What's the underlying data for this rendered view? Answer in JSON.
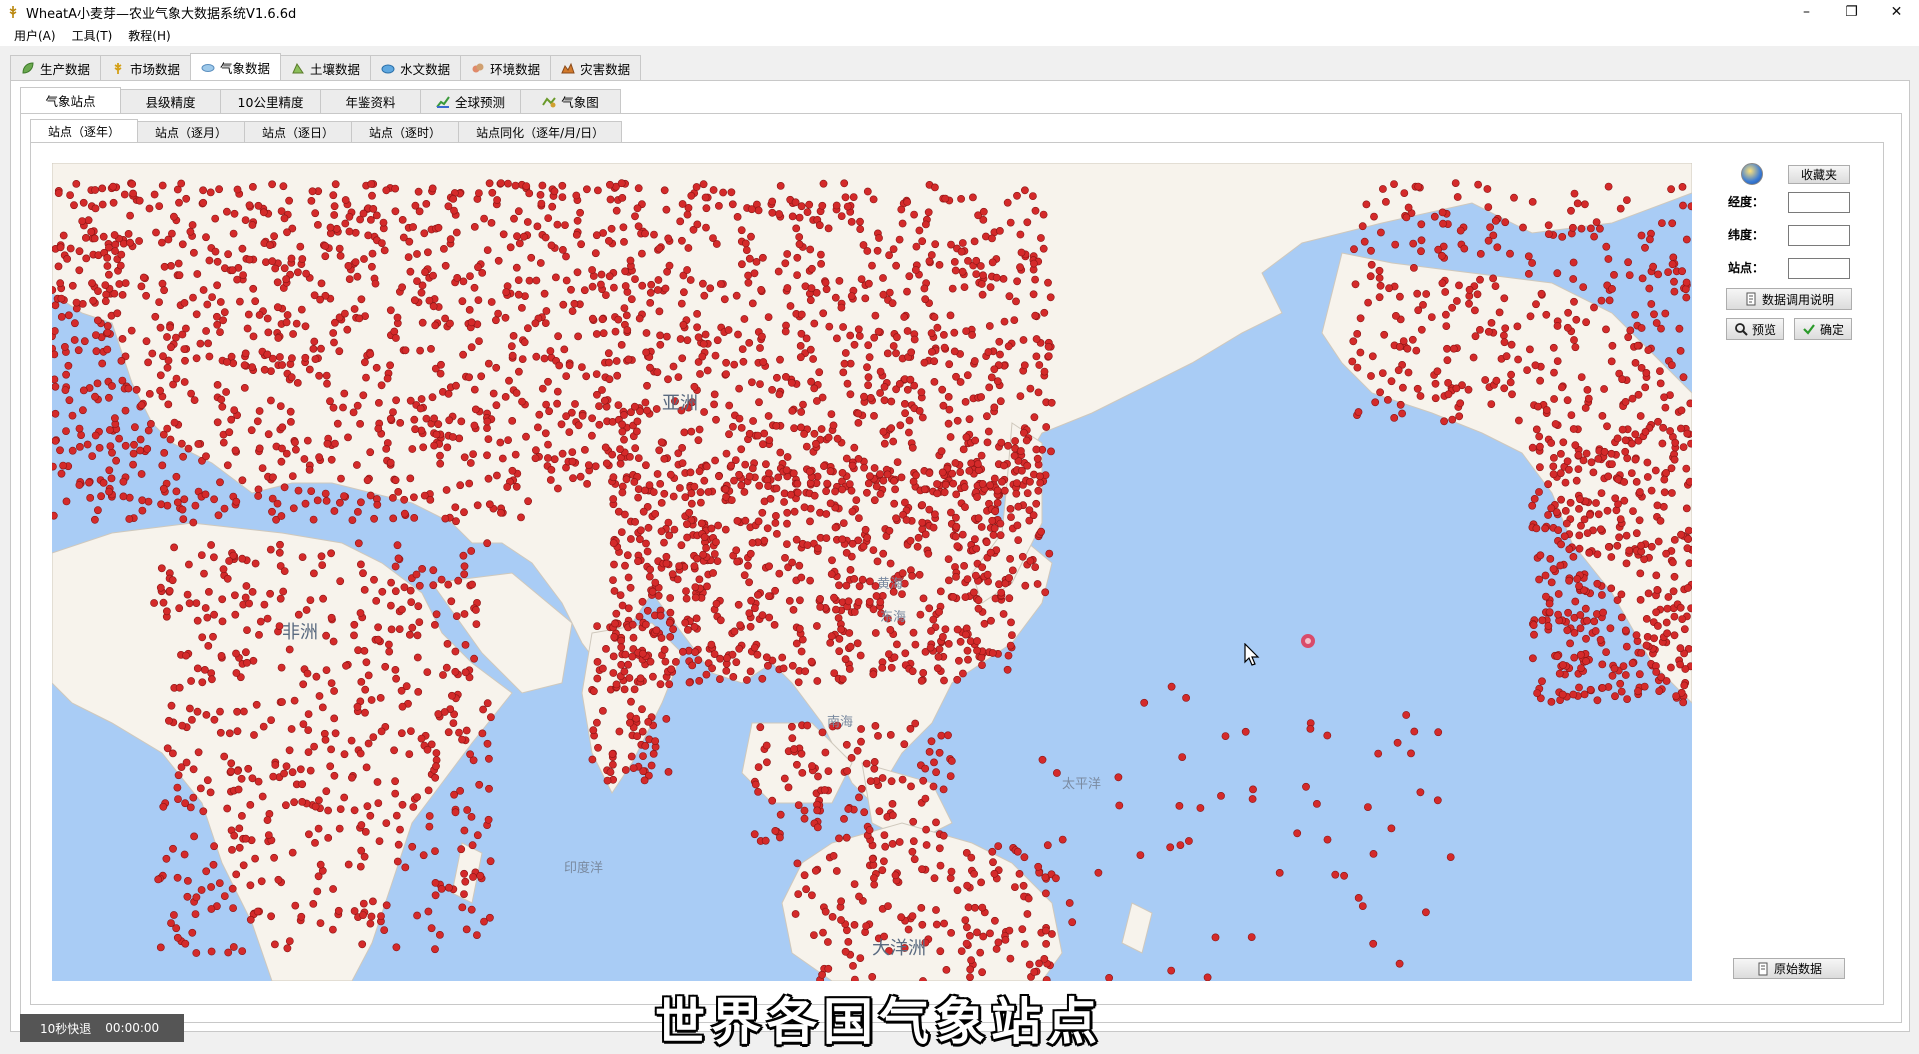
{
  "window": {
    "title": "WheatA小麦芽—农业气象大数据系统V1.6.6d",
    "minimize": "–",
    "restore": "❐",
    "close": "✕"
  },
  "menu": [
    "用户(A)",
    "工具(T)",
    "教程(H)"
  ],
  "main_tabs": [
    {
      "label": "生产数据",
      "icon": "leaf-icon"
    },
    {
      "label": "市场数据",
      "icon": "wheat-icon"
    },
    {
      "label": "气象数据",
      "icon": "cloud-icon",
      "active": true
    },
    {
      "label": "土壤数据",
      "icon": "soil-icon"
    },
    {
      "label": "水文数据",
      "icon": "water-icon"
    },
    {
      "label": "环境数据",
      "icon": "environment-icon"
    },
    {
      "label": "灾害数据",
      "icon": "disaster-icon"
    }
  ],
  "sub_tabs": [
    {
      "label": "气象站点",
      "active": true
    },
    {
      "label": "县级精度"
    },
    {
      "label": "10公里精度"
    },
    {
      "label": "年鉴资料"
    },
    {
      "label": "全球预测",
      "icon": "chart-icon"
    },
    {
      "label": "气象图",
      "icon": "weather-map-icon"
    }
  ],
  "station_tabs": [
    {
      "label": "站点（逐年）",
      "active": true
    },
    {
      "label": "站点（逐月）"
    },
    {
      "label": "站点（逐日）"
    },
    {
      "label": "站点（逐时）"
    },
    {
      "label": "站点同化（逐年/月/日）"
    }
  ],
  "map": {
    "labels": {
      "asia": "亚洲",
      "africa": "非洲",
      "yellow_sea": "黄海",
      "east_sea": "东海",
      "south_sea": "南海",
      "pacific": "太平洋",
      "indian_ocean": "印度洋",
      "oceania": "大洋洲"
    },
    "marker_color": "#d42a2a",
    "ocean_color": "#a9ccf5",
    "land_color": "#f7f3ec"
  },
  "right_panel": {
    "favorites_button": "收藏夹",
    "longitude_label": "经度：",
    "latitude_label": "纬度：",
    "station_label": "站点：",
    "longitude_value": "",
    "latitude_value": "",
    "station_value": "",
    "data_usage_button": "数据调用说明",
    "preview_button": "预览",
    "confirm_button": "确定",
    "raw_data_button": "原始数据"
  },
  "status": {
    "rewind_label": "10秒快退",
    "time": "00:00:00"
  },
  "caption": "世界各国气象站点"
}
